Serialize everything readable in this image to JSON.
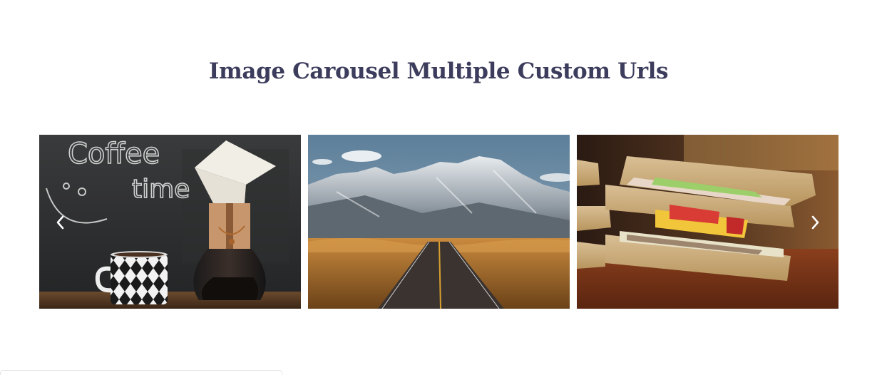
{
  "heading": {
    "title": "Image Carousel Multiple Custom Urls"
  },
  "carousel": {
    "slides": [
      {
        "id": "coffee",
        "chalk_text_line1": "Coffee",
        "chalk_text_line2": "time"
      },
      {
        "id": "mountain-road"
      },
      {
        "id": "sandwich"
      }
    ],
    "prev_icon": "chevron-left-icon",
    "next_icon": "chevron-right-icon"
  },
  "colors": {
    "title": "#3c3c5c",
    "background": "#ffffff",
    "arrow": "#ffffff"
  }
}
